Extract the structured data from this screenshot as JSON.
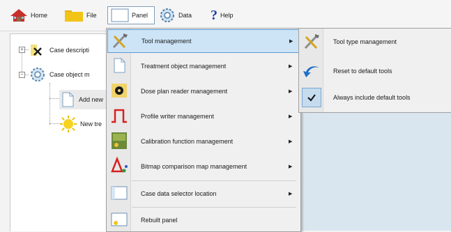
{
  "toolbar": {
    "home": "Home",
    "file": "File",
    "panel": "Panel",
    "data": "Data",
    "help": "Help"
  },
  "tree": {
    "nodes": [
      {
        "label": "Case descripti",
        "icon": "pin-icon"
      },
      {
        "label": "Case object m",
        "icon": "gear-icon"
      },
      {
        "label": "Add new",
        "icon": "document-icon"
      },
      {
        "label": "New tre",
        "icon": "sun-icon"
      }
    ]
  },
  "menu": {
    "items": [
      {
        "label": "Tool management",
        "icon": "tools-icon",
        "submenu": true
      },
      {
        "label": "Treatment object management",
        "icon": "document-icon",
        "submenu": true
      },
      {
        "label": "Dose plan reader management",
        "icon": "radiation-icon",
        "submenu": true
      },
      {
        "label": "Profile writer management",
        "icon": "profile-pulse-icon",
        "submenu": true
      },
      {
        "label": "Calibration function management",
        "icon": "calibration-icon",
        "submenu": true
      },
      {
        "label": "Bitmap comparison map management",
        "icon": "triangle-compare-icon",
        "submenu": true
      },
      {
        "label": "Case data selector location",
        "icon": "panel-layout-icon",
        "submenu": true
      },
      {
        "label": "Rebuilt panel",
        "icon": "panel-rebuild-icon",
        "submenu": false
      }
    ],
    "arrow": "▶"
  },
  "submenu": {
    "items": [
      {
        "label": "Tool type management",
        "icon": "tools-icon"
      },
      {
        "label": "Reset to default tools",
        "icon": "undo-arrow-icon"
      },
      {
        "label": "Always include default tools",
        "icon": "check-icon",
        "checked": true
      }
    ]
  },
  "colors": {
    "highlight_bg": "#cde4f7",
    "highlight_border": "#5b9bd5",
    "background_panel": "#dae6ef"
  }
}
